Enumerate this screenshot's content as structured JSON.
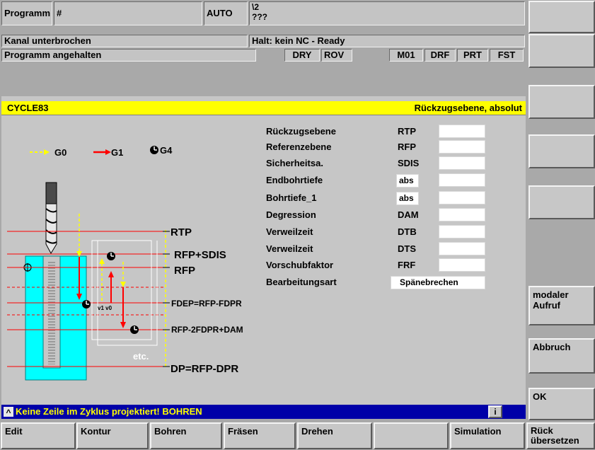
{
  "header": {
    "program_label": "Programm",
    "program_name": "#",
    "mode": "AUTO",
    "path_line1": "\\2",
    "path_line2": "???",
    "channel_status": "Kanal unterbrochen",
    "nc_status": "Halt: kein NC - Ready",
    "program_status": "Programm angehalten",
    "indicators": [
      "DRY",
      "ROV",
      "M01",
      "DRF",
      "PRT",
      "FST"
    ]
  },
  "cycle": {
    "name": "CYCLE83",
    "current_param_desc": "Rückzugsebene, absolut"
  },
  "legend": {
    "g0": "G0",
    "g1": "G1",
    "g4": "G4"
  },
  "diagram": {
    "rtp": "RTP",
    "rfp_sdis": "RFP+SDIS",
    "rfp": "RFP",
    "fdep": "FDEP=RFP-FDPR",
    "rfp2": "RFP-2FDPR+DAM",
    "dp": "DP=RFP-DPR",
    "etc": "etc.",
    "v1v0": "v1 v0"
  },
  "params": [
    {
      "label": "Rückzugsebene",
      "code": "RTP",
      "value": ""
    },
    {
      "label": "Referenzebene",
      "code": "RFP",
      "value": ""
    },
    {
      "label": "Sicherheitsa.",
      "code": "SDIS",
      "value": ""
    },
    {
      "label": "Endbohrtiefe",
      "code": "abs",
      "value": ""
    },
    {
      "label": "Bohrtiefe_1",
      "code": "abs",
      "value": ""
    },
    {
      "label": "Degression",
      "code": "DAM",
      "value": ""
    },
    {
      "label": "Verweilzeit",
      "code": "DTB",
      "value": ""
    },
    {
      "label": "Verweilzeit",
      "code": "DTS",
      "value": ""
    },
    {
      "label": "Vorschubfaktor",
      "code": "FRF",
      "value": ""
    },
    {
      "label": "Bearbeitungsart",
      "code": "",
      "value": "Spänebrechen"
    }
  ],
  "message": {
    "caret": "^",
    "text": "Keine Zeile im Zyklus projektiert! BOHREN",
    "info": "i"
  },
  "bottom_softkeys": [
    "Edit",
    "Kontur",
    "Bohren",
    "Fräsen",
    "Drehen",
    "",
    "Simulation"
  ],
  "back_key": {
    "line1": "Rück",
    "line2": "übersetzen"
  },
  "vertical_softkeys": [
    "",
    "",
    "",
    "",
    "",
    "modaler Aufruf",
    "Abbruch",
    "OK"
  ],
  "colors": {
    "title_bar": "#ffff00",
    "blue_bar": "#0000a8",
    "message_text": "#ffff00",
    "g1_arrow": "#ff0000",
    "g0_arrow": "#ffff00",
    "workpiece": "#00ffff"
  }
}
